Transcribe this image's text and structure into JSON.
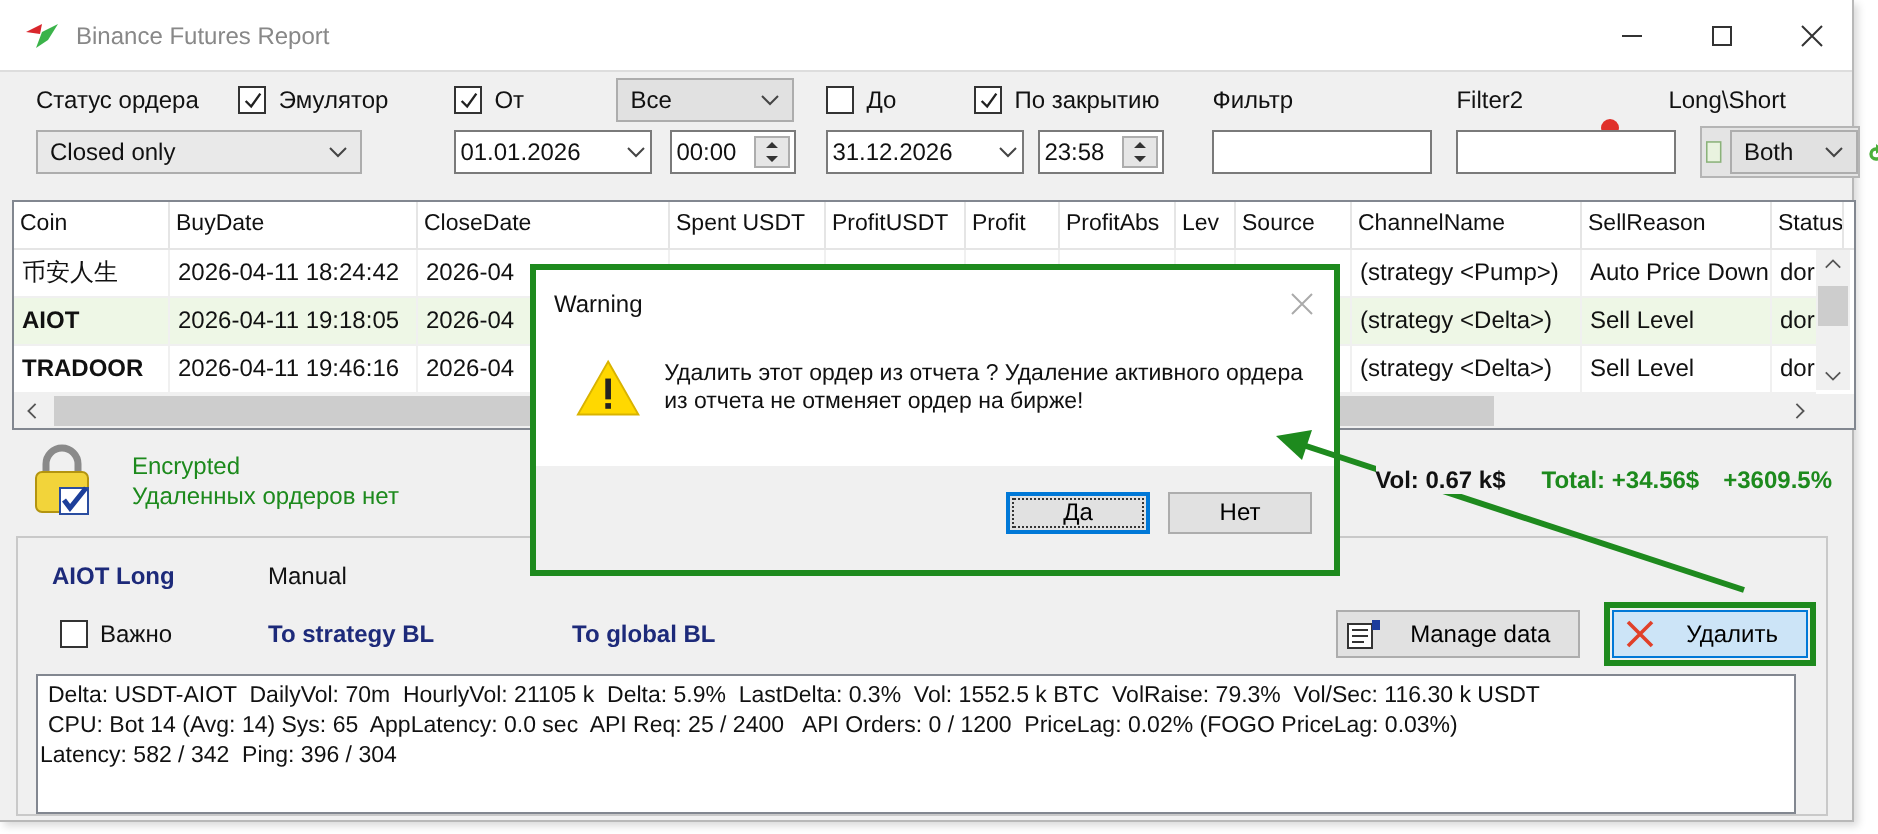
{
  "window": {
    "title": "Binance Futures Report"
  },
  "filters": {
    "status_label": "Статус ордера",
    "status_value": "Closed only",
    "emulator": {
      "label": "Эмулятор",
      "checked": true
    },
    "from": {
      "label": "От",
      "checked": true
    },
    "range_value": "Все",
    "from_date": "01.01.2026",
    "from_time": "00:00",
    "to": {
      "label": "До",
      "checked": false
    },
    "to_date": "31.12.2026",
    "by_close": {
      "label": "По закрытию",
      "checked": true
    },
    "to_time": "23:58",
    "filter_label": "Фильтр",
    "filter2_label": "Filter2",
    "side_label": "Long\\Short",
    "side_value": "Both"
  },
  "table": {
    "columns": [
      "Coin",
      "BuyDate",
      "CloseDate",
      "Spent USDT",
      "ProfitUSDT",
      "Profit",
      "ProfitAbs",
      "Lev",
      "Source",
      "ChannelName",
      "SellReason",
      "Status"
    ],
    "rows": [
      {
        "coin": "币安人生",
        "bold": false,
        "buy_date": "2026-04-11 18:24:42",
        "close_date": "2026-04",
        "channel": "(strategy <Pump>)",
        "sell_reason": "Auto Price Down",
        "status": "dor",
        "selected": false
      },
      {
        "coin": "AIOT",
        "bold": true,
        "buy_date": "2026-04-11 19:18:05",
        "close_date": "2026-04",
        "channel": "(strategy <Delta>)",
        "sell_reason": "Sell Level",
        "status": "dor",
        "selected": true
      },
      {
        "coin": "TRADOOR",
        "bold": true,
        "buy_date": "2026-04-11 19:46:16",
        "close_date": "2026-04",
        "channel": "(strategy <Delta>)",
        "sell_reason": "Sell Level",
        "status": "dor",
        "selected": false
      }
    ]
  },
  "summary": {
    "encrypted": "Encrypted",
    "deleted": "Удаленных ордеров нет",
    "vol": "Vol: 0.67 k$",
    "total": "Total: +34.56$",
    "total_pct": "+3609.5%"
  },
  "details": {
    "title": "AIOT Long",
    "mode": "Manual",
    "important": {
      "label": "Важно",
      "checked": false
    },
    "links": [
      "To strategy BL",
      "To global BL"
    ],
    "manage_button": "Manage data",
    "delete_button": "Удалить",
    "log": [
      "Delta: USDT-AIOT  DailyVol: 70m  HourlyVol: 21105 k  Delta: 5.9%  LastDelta: 0.3%  Vol: 1552.5 k BTC  VolRaise: 79.3%  Vol/Sec: 116.30 k USDT",
      "CPU: Bot 14 (Avg: 14) Sys: 65  AppLatency: 0.0 sec  API Req: 25 / 2400   API Orders: 0 / 1200  PriceLag: 0.02% (FOGO PriceLag: 0.03%)",
      "Latency: 582 / 342  Ping: 396 / 304"
    ]
  },
  "dialog": {
    "title": "Warning",
    "message": "Удалить этот ордер из отчета ? Удаление активного ордера из отчета не отменяет ордер на бирже!",
    "buttons": [
      {
        "label": "Да",
        "selected": true
      },
      {
        "label": "Нет",
        "selected": false
      }
    ]
  }
}
